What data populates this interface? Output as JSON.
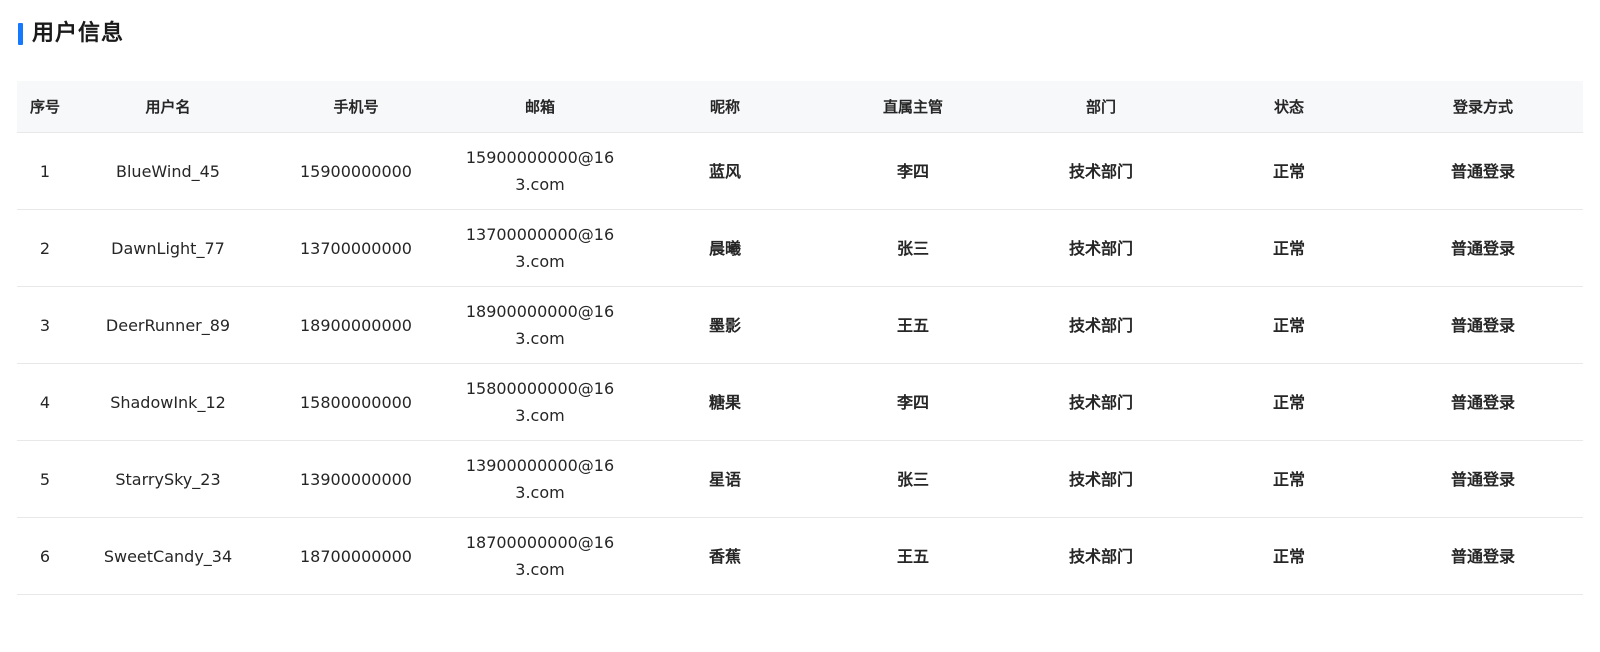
{
  "section": {
    "title": "用户信息",
    "accent_color": "#1677ff"
  },
  "table": {
    "columns": [
      "序号",
      "用户名",
      "手机号",
      "邮箱",
      "昵称",
      "直属主管",
      "部门",
      "状态",
      "登录方式"
    ],
    "rows": [
      {
        "index": "1",
        "username": "BlueWind_45",
        "phone": "15900000000",
        "email": "15900000000@163.com",
        "nickname": "蓝风",
        "manager": "李四",
        "department": "技术部门",
        "status": "正常",
        "login": "普通登录"
      },
      {
        "index": "2",
        "username": "DawnLight_77",
        "phone": "13700000000",
        "email": "13700000000@163.com",
        "nickname": "晨曦",
        "manager": "张三",
        "department": "技术部门",
        "status": "正常",
        "login": "普通登录"
      },
      {
        "index": "3",
        "username": "DeerRunner_89",
        "phone": "18900000000",
        "email": "18900000000@163.com",
        "nickname": "墨影",
        "manager": "王五",
        "department": "技术部门",
        "status": "正常",
        "login": "普通登录"
      },
      {
        "index": "4",
        "username": "ShadowInk_12",
        "phone": "15800000000",
        "email": "15800000000@163.com",
        "nickname": "糖果",
        "manager": "李四",
        "department": "技术部门",
        "status": "正常",
        "login": "普通登录"
      },
      {
        "index": "5",
        "username": "StarrySky_23",
        "phone": "13900000000",
        "email": "13900000000@163.com",
        "nickname": "星语",
        "manager": "张三",
        "department": "技术部门",
        "status": "正常",
        "login": "普通登录"
      },
      {
        "index": "6",
        "username": "SweetCandy_34",
        "phone": "18700000000",
        "email": "18700000000@163.com",
        "nickname": "香蕉",
        "manager": "王五",
        "department": "技术部门",
        "status": "正常",
        "login": "普通登录"
      }
    ]
  }
}
